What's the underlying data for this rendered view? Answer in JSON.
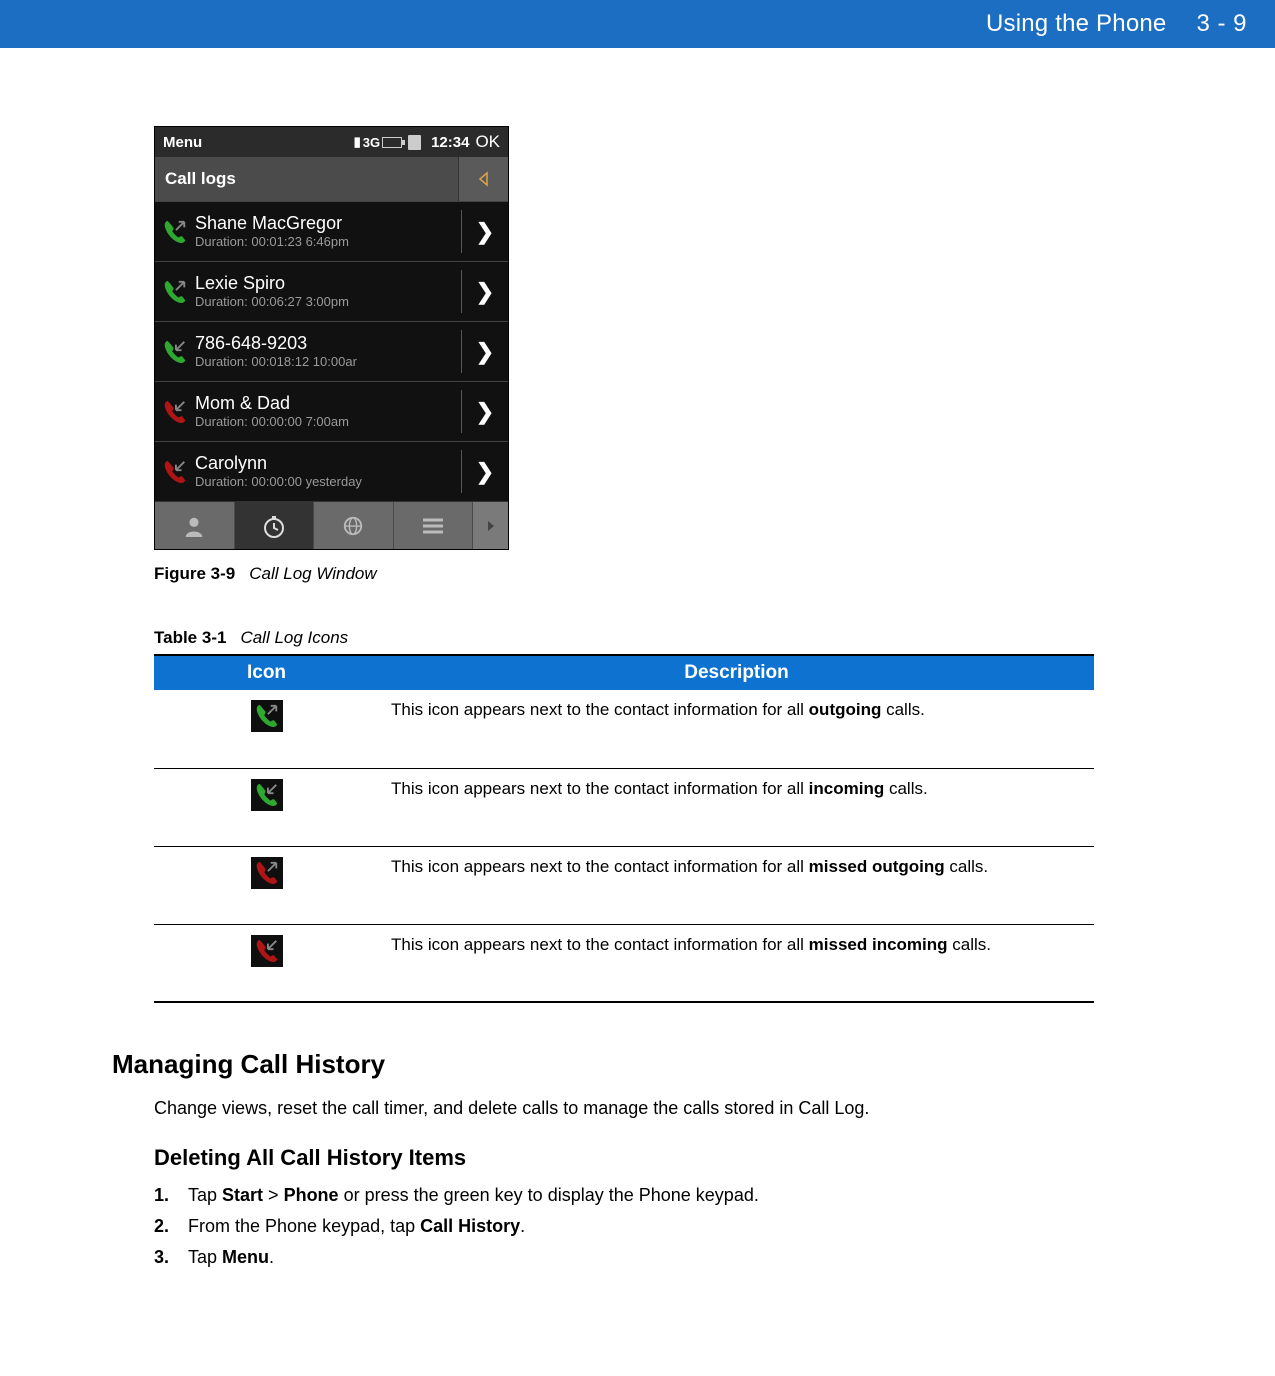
{
  "header": {
    "title": "Using the Phone",
    "page": "3 - 9"
  },
  "phone": {
    "status": {
      "menu": "Menu",
      "net": "3G",
      "time": "12:34",
      "ok": "OK"
    },
    "headerLabel": "Call logs",
    "rows": [
      {
        "name": "Shane MacGregor",
        "detail": "Duration: 00:01:23 6:46pm",
        "type": "outgoing"
      },
      {
        "name": "Lexie Spiro",
        "detail": "Duration: 00:06:27 3:00pm",
        "type": "outgoing"
      },
      {
        "name": "786-648-9203",
        "detail": "Duration: 00:018:12     10:00ar",
        "type": "incoming"
      },
      {
        "name": "Mom & Dad",
        "detail": "Duration: 00:00:00 7:00am",
        "type": "missed"
      },
      {
        "name": "Carolynn",
        "detail": "Duration: 00:00:00 yesterday",
        "type": "missed"
      }
    ]
  },
  "figureCaption": {
    "label": "Figure 3-9",
    "title": "Call Log Window"
  },
  "tableCaption": {
    "label": "Table 3-1",
    "title": "Call Log Icons"
  },
  "tableHeaders": {
    "icon": "Icon",
    "description": "Description"
  },
  "tableRows": [
    {
      "prefix": "This icon appears next to the contact information for all ",
      "bold": "outgoing",
      "suffix": " calls.",
      "icon": "outgoing"
    },
    {
      "prefix": "This icon appears next to the contact information for all ",
      "bold": "incoming",
      "suffix": " calls.",
      "icon": "incoming"
    },
    {
      "prefix": "This icon appears next to the contact information for all ",
      "bold": "missed outgoing",
      "suffix": " calls.",
      "icon": "missed-outgoing"
    },
    {
      "prefix": "This icon appears next to the contact information for all ",
      "bold": "missed incoming",
      "suffix": " calls.",
      "icon": "missed-incoming"
    }
  ],
  "section": {
    "h2": "Managing Call History",
    "p": "Change views, reset the call timer, and delete calls to manage the calls stored in Call Log.",
    "h3": "Deleting All Call History Items",
    "steps": [
      {
        "num": "1.",
        "parts": [
          "Tap ",
          "Start",
          " > ",
          "Phone",
          " or press the green key to display the Phone keypad."
        ]
      },
      {
        "num": "2.",
        "parts": [
          "From the Phone keypad, tap ",
          "Call History",
          "."
        ]
      },
      {
        "num": "3.",
        "parts": [
          "Tap ",
          "Menu",
          "."
        ]
      }
    ]
  }
}
